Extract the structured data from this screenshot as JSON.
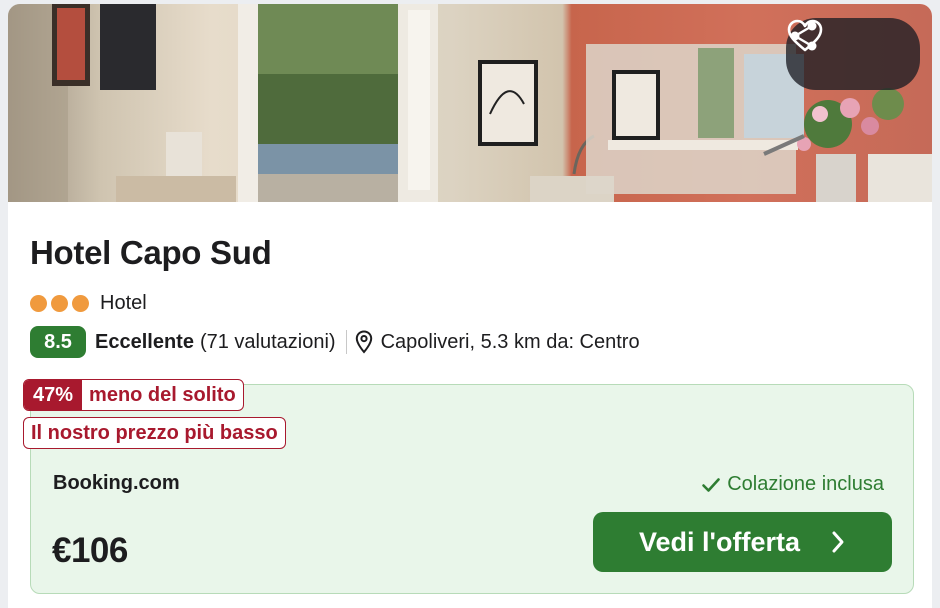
{
  "hotel": {
    "name": "Hotel Capo Sud",
    "stars": 3,
    "type": "Hotel",
    "score": "8.5",
    "rating_word": "Eccellente",
    "rating_count": "(71 valutazioni)",
    "location": "Capoliveri, 5.3 km da: Centro"
  },
  "photo_actions": {
    "share_icon": "share-icon",
    "favorite_icon": "heart-outline-icon"
  },
  "deal": {
    "discount_pct": "47%",
    "discount_text": "meno del solito",
    "lowest_price_label": "Il nostro prezzo più basso",
    "provider": "Booking.com",
    "breakfast": "Colazione inclusa",
    "price": "€106",
    "cta_label": "Vedi l'offerta"
  },
  "colors": {
    "score_green": "#2e7d32",
    "deal_background": "#e9f6ea",
    "discount_red": "#a8192e",
    "star_orange": "#f09a3e"
  }
}
